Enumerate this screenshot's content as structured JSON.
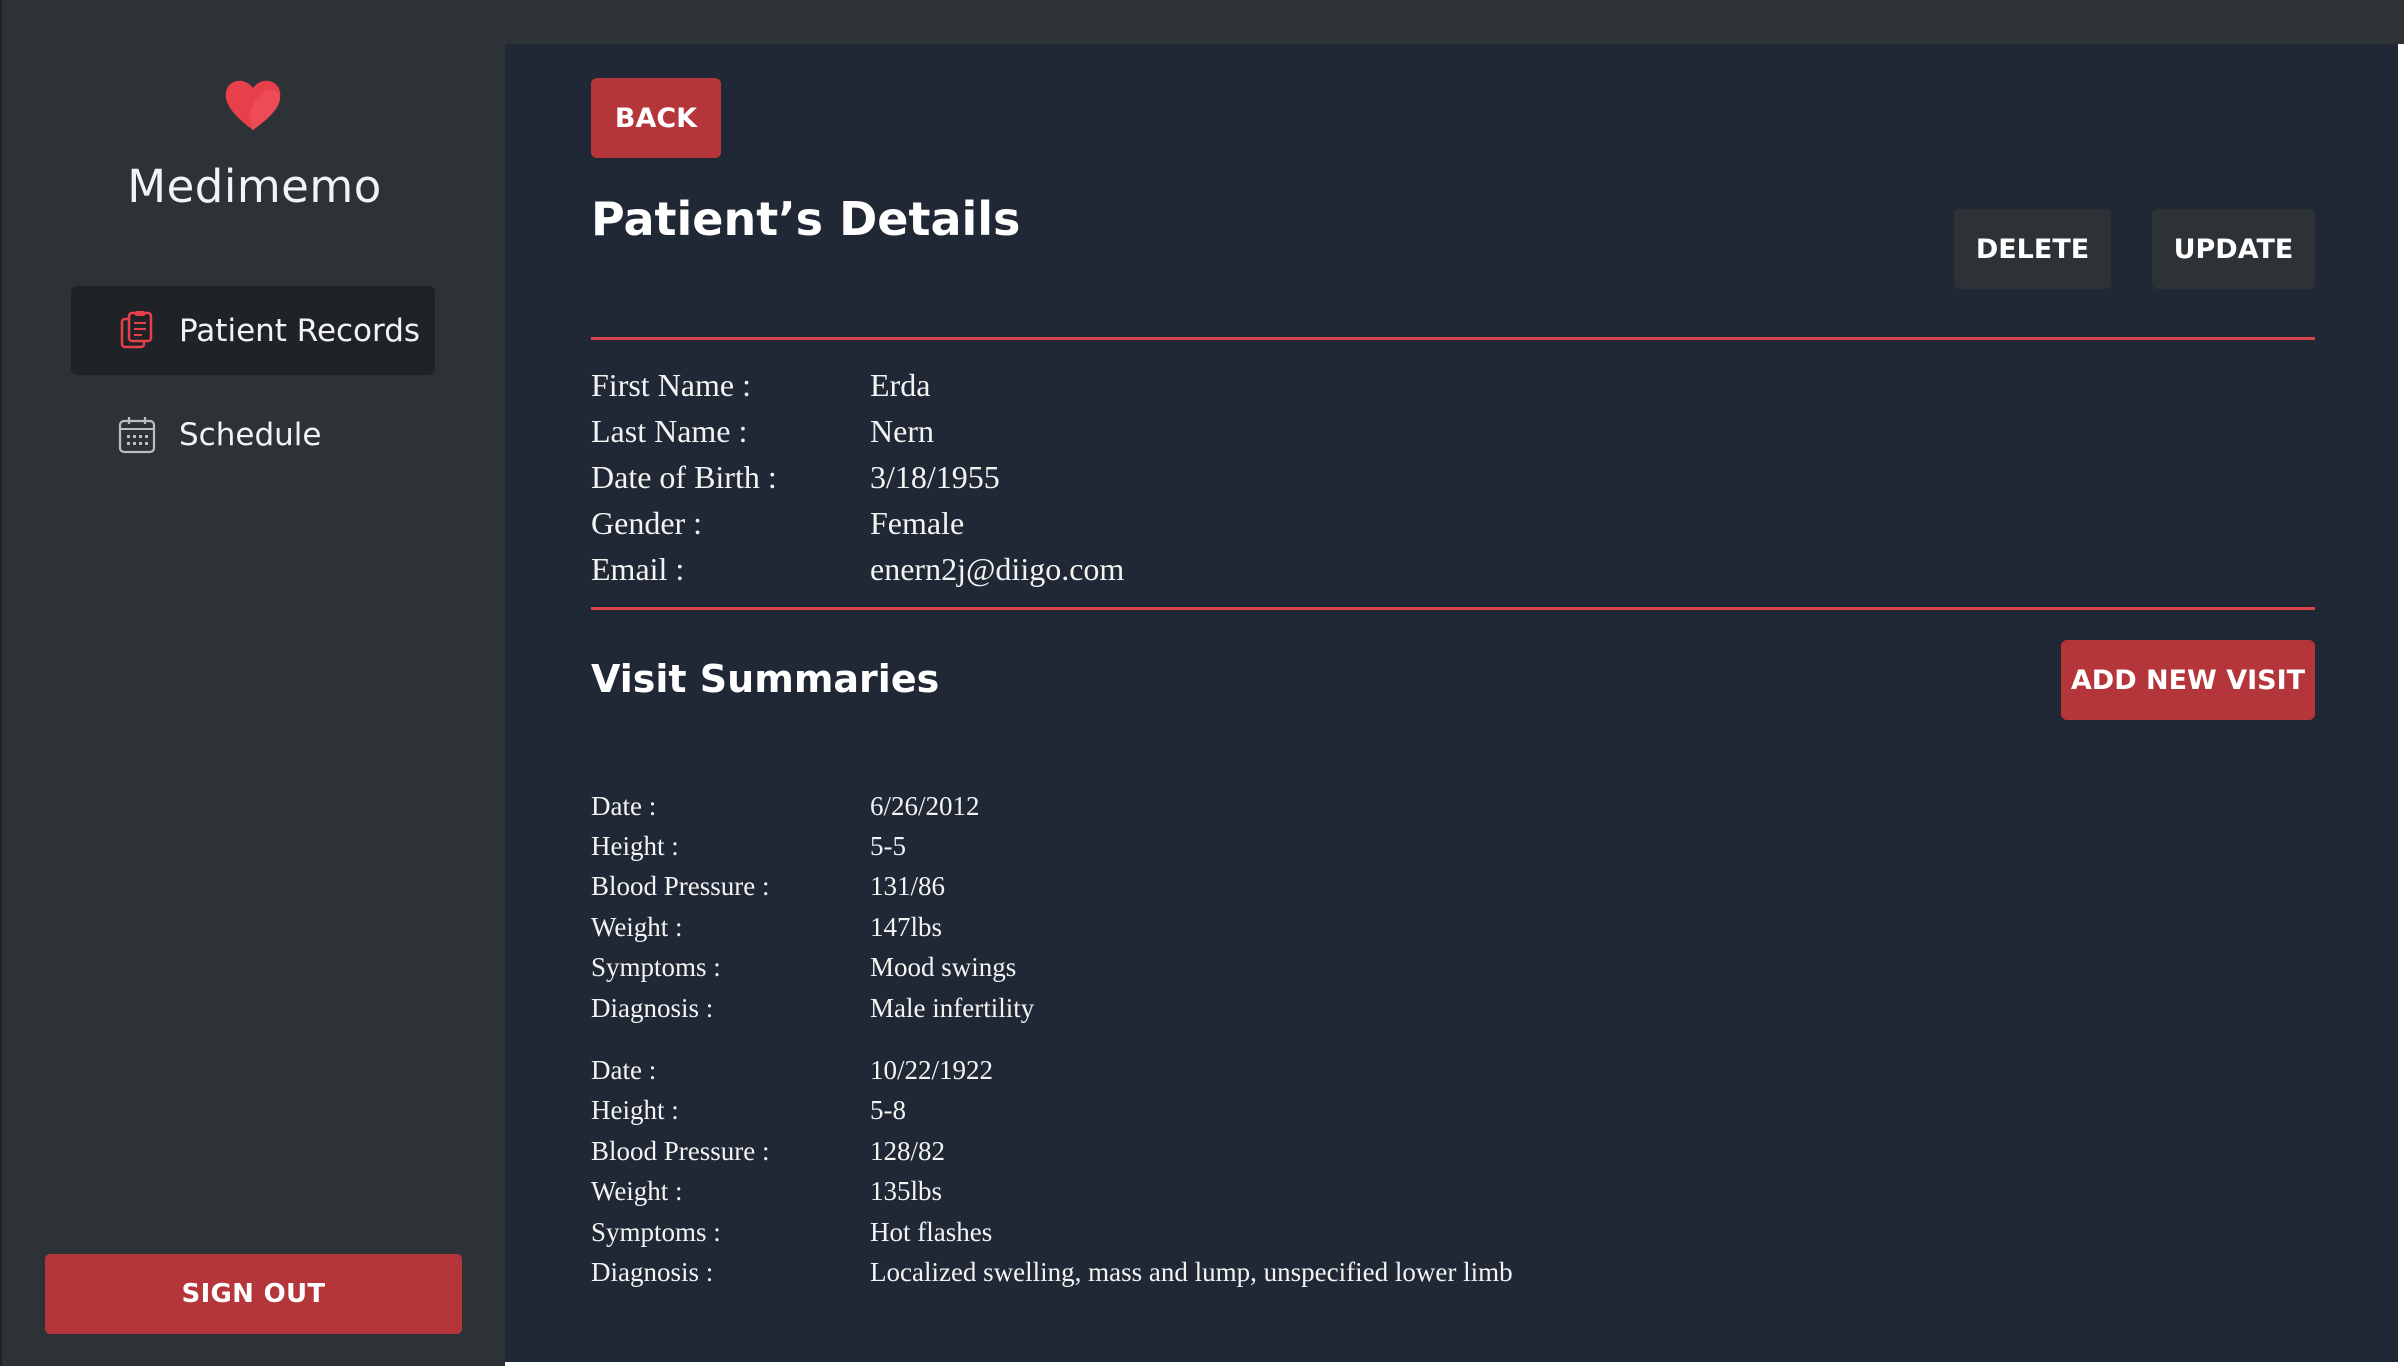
{
  "app": {
    "name": "Medimemo"
  },
  "sidebar": {
    "items": [
      {
        "label": "Patient Records",
        "icon": "clipboard-icon",
        "active": true
      },
      {
        "label": "Schedule",
        "icon": "calendar-icon",
        "active": false
      }
    ],
    "signout_label": "SIGN OUT"
  },
  "main": {
    "back_label": "BACK",
    "title": "Patient’s Details",
    "delete_label": "DELETE",
    "update_label": "UPDATE",
    "patient": [
      {
        "label": "First Name :",
        "value": "Erda"
      },
      {
        "label": "Last Name :",
        "value": "Nern"
      },
      {
        "label": "Date of Birth :",
        "value": "3/18/1955"
      },
      {
        "label": "Gender :",
        "value": "Female"
      },
      {
        "label": "Email :",
        "value": "enern2j@diigo.com"
      }
    ],
    "visits_title": "Visit Summaries",
    "add_visit_label": "ADD NEW VISIT",
    "visits": [
      {
        "fields": [
          {
            "label": "Date :",
            "value": "6/26/2012"
          },
          {
            "label": "Height :",
            "value": "5-5"
          },
          {
            "label": "Blood Pressure :",
            "value": "131/86"
          },
          {
            "label": "Weight :",
            "value": "147lbs"
          },
          {
            "label": "Symptoms :",
            "value": "Mood swings"
          },
          {
            "label": "Diagnosis :",
            "value": "Male infertility"
          }
        ]
      },
      {
        "fields": [
          {
            "label": "Date :",
            "value": "10/22/1922"
          },
          {
            "label": "Height :",
            "value": "5-8"
          },
          {
            "label": "Blood Pressure :",
            "value": "128/82"
          },
          {
            "label": "Weight :",
            "value": "135lbs"
          },
          {
            "label": "Symptoms :",
            "value": "Hot flashes"
          },
          {
            "label": "Diagnosis :",
            "value": "Localized swelling, mass and lump, unspecified lower limb"
          }
        ]
      }
    ]
  },
  "colors": {
    "sidebar_bg": "#2d3237",
    "main_bg": "#202836",
    "accent_red": "#b4363b",
    "divider_red": "#d8454b",
    "heart": "#e8404a"
  }
}
